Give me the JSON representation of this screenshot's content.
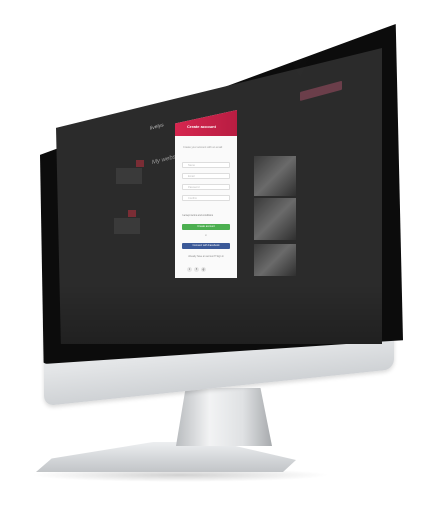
{
  "device": {
    "logo_glyph": "",
    "colors": {
      "bezel": "#0c0c0c",
      "aluminum": "#e3e5e7",
      "modal_header": "#d6264f"
    }
  },
  "screen": {
    "topbar": {
      "brand": "livelys"
    },
    "page_heading": "My websites"
  },
  "modal": {
    "title": "Create  account",
    "subtitle": "Create your account with an email",
    "fields": [
      {
        "placeholder": "Name"
      },
      {
        "placeholder": "Email"
      },
      {
        "placeholder": "Password"
      },
      {
        "placeholder": "Confirm"
      }
    ],
    "checkbox_label": "I accept terms and conditions",
    "submit_label": "Create account",
    "or_label": "or",
    "facebook_label": "Connect with Facebook",
    "signin_text": "Already have an account? Sign in"
  },
  "socials": [
    {
      "icon": "twitter-icon",
      "glyph": "t"
    },
    {
      "icon": "facebook-icon",
      "glyph": "f"
    },
    {
      "icon": "google-icon",
      "glyph": "g"
    }
  ]
}
